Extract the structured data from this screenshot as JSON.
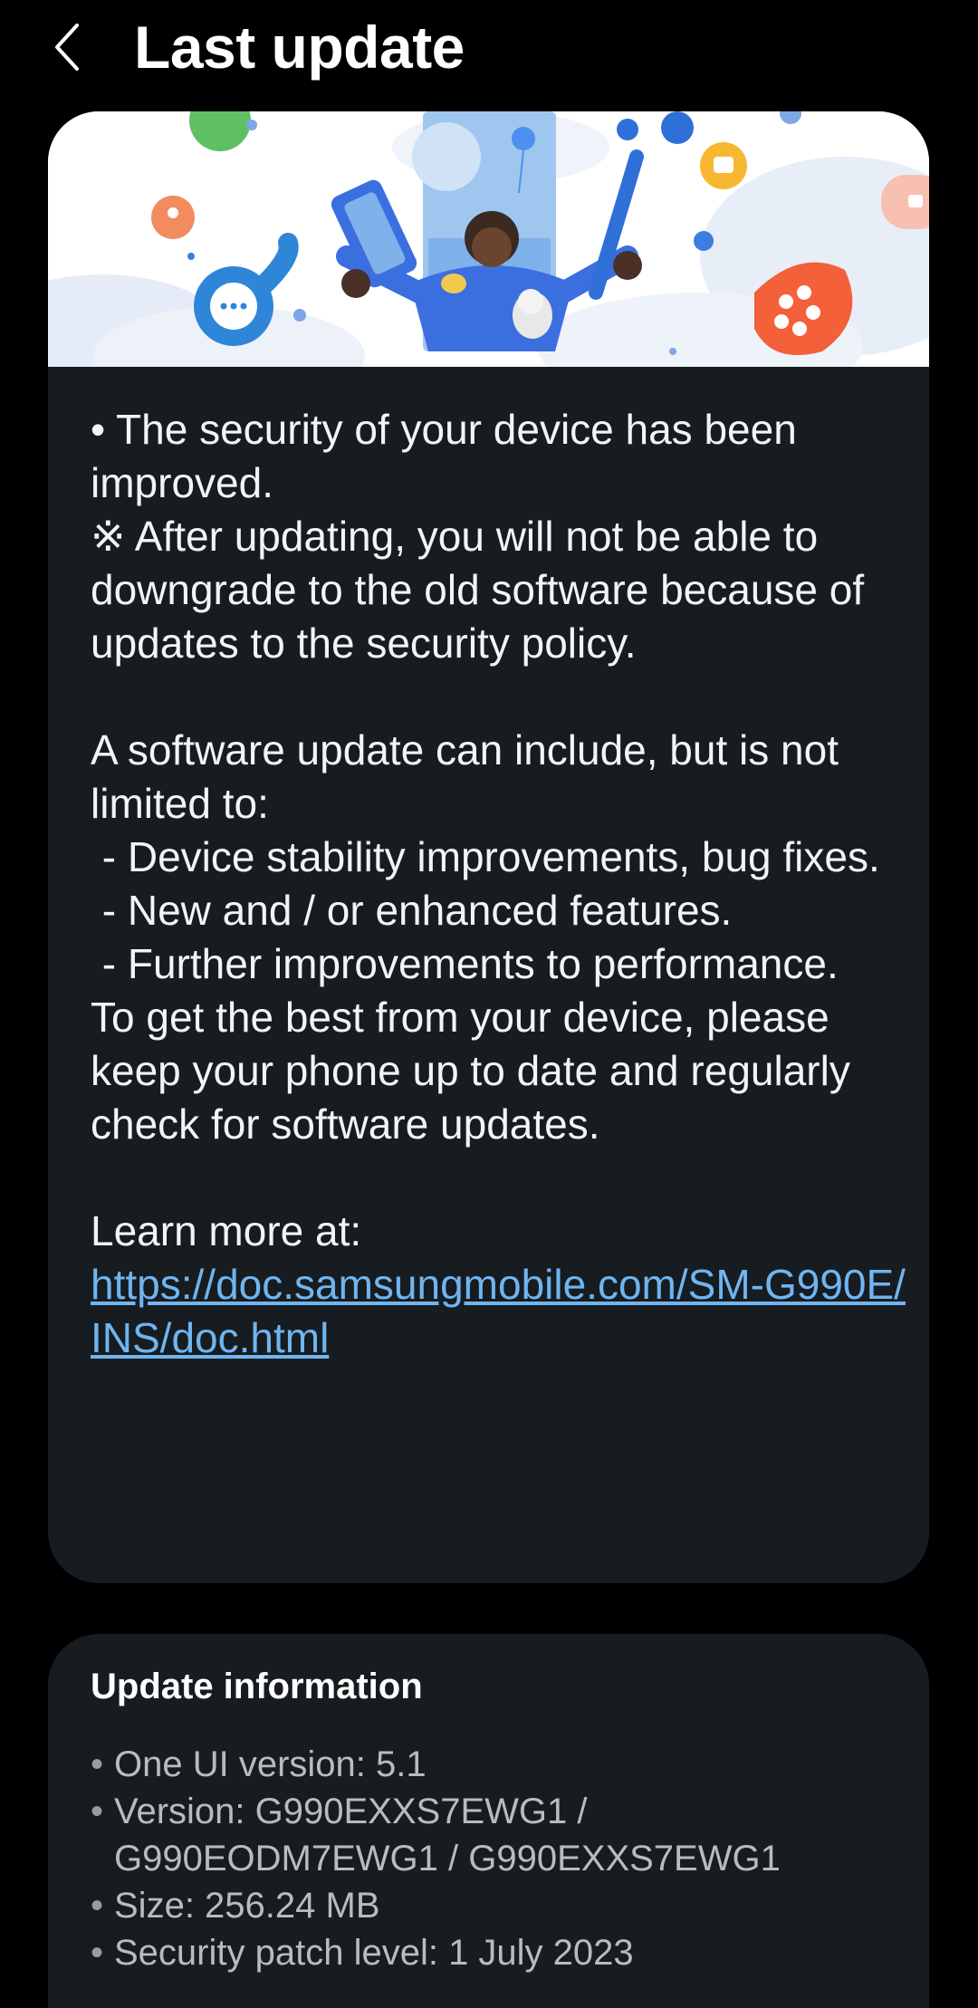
{
  "header": {
    "title": "Last update",
    "back_icon": "chevron-left-icon"
  },
  "release_notes": {
    "security_line": "• The security of your device has been improved.",
    "downgrade_note": "※ After updating, you will not be able to downgrade to the old software because of updates to the security policy.",
    "intro": "A software update can include, but is not limited to:",
    "items": [
      " - Device stability improvements, bug fixes.",
      " - New and / or enhanced features.",
      " - Further improvements to performance."
    ],
    "advice": "To get the best from your device, please keep your phone up to date and regularly check for software updates.",
    "learn_more_label": "Learn more at:",
    "learn_more_url": "https://doc.samsungmobile.com/SM-G990E/INS/doc.html"
  },
  "update_info": {
    "title": "Update information",
    "one_ui": "One UI version: 5.1",
    "version": "Version: G990EXXS7EWG1 / G990EODM7EWG1 / G990EXXS7EWG1",
    "size": "Size: 256.24 MB",
    "security_patch": "Security patch level: 1 July 2023"
  },
  "colors": {
    "background": "#000000",
    "card": "#171c20",
    "link": "#6fb5f0",
    "secondary_text": "#b9bcbf"
  }
}
